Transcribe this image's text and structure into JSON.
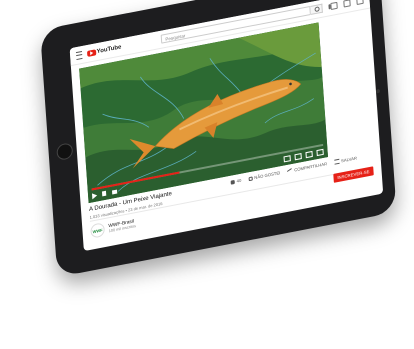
{
  "header": {
    "logo_text": "YouTube",
    "search_placeholder": "Pesquisar"
  },
  "player": {
    "progress": 0.38,
    "time_current": "",
    "time_total": ""
  },
  "video": {
    "title": "A Dourada - Um Peixe Viajante",
    "meta": "1.033 visualizações • 23 de mar. de 2016"
  },
  "actions": {
    "like_count": "40",
    "dislike_label": "NÃO GOSTEI",
    "share_label": "COMPARTILHAR",
    "save_label": "SALVAR"
  },
  "channel": {
    "name": "WWF-Brasil",
    "subs": "100 mil inscritos",
    "avatar_text": "WWF"
  },
  "subscribe_label": "INSCREVER-SE",
  "colors": {
    "brand_red": "#e62117",
    "video_green": "#2f6b2f",
    "fish_orange": "#e59a3b"
  }
}
